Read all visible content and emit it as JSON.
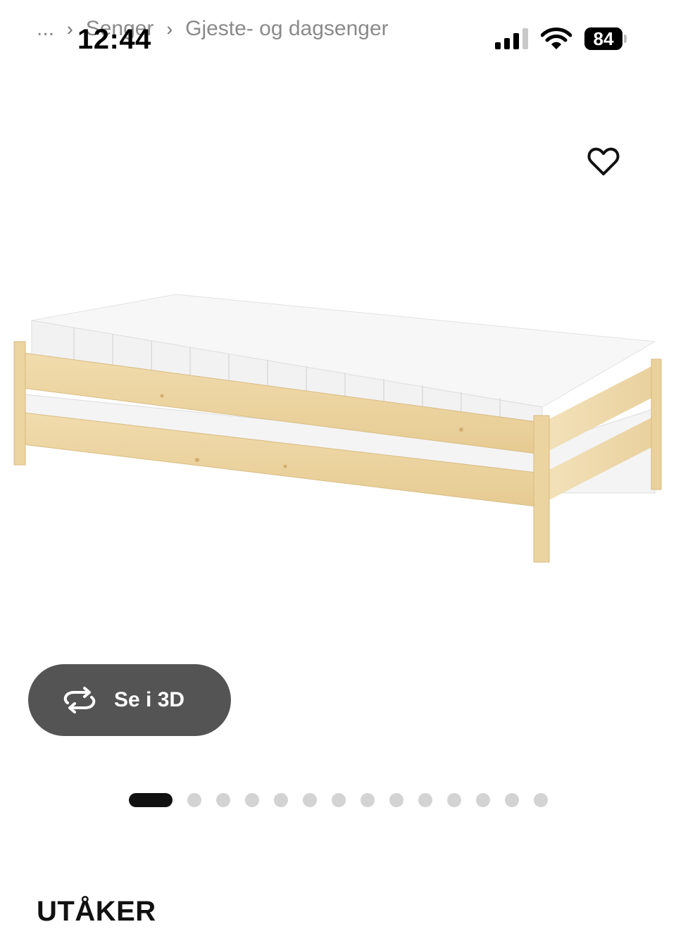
{
  "status_bar": {
    "time": "12:44",
    "battery": "84"
  },
  "breadcrumb": {
    "ellipsis": "...",
    "items": [
      "Senger",
      "Gjeste- og dagsenger"
    ],
    "separator": "›"
  },
  "product": {
    "three_d_button_label": "Se i 3D",
    "title": "UTÅKER"
  },
  "carousel": {
    "total_slides": 14,
    "active_index": 0
  },
  "icons": {
    "favorite": "heart-outline-icon",
    "rotate": "rotate-3d-icon",
    "signal": "cellular-signal-icon",
    "wifi": "wifi-icon",
    "battery": "battery-icon"
  }
}
